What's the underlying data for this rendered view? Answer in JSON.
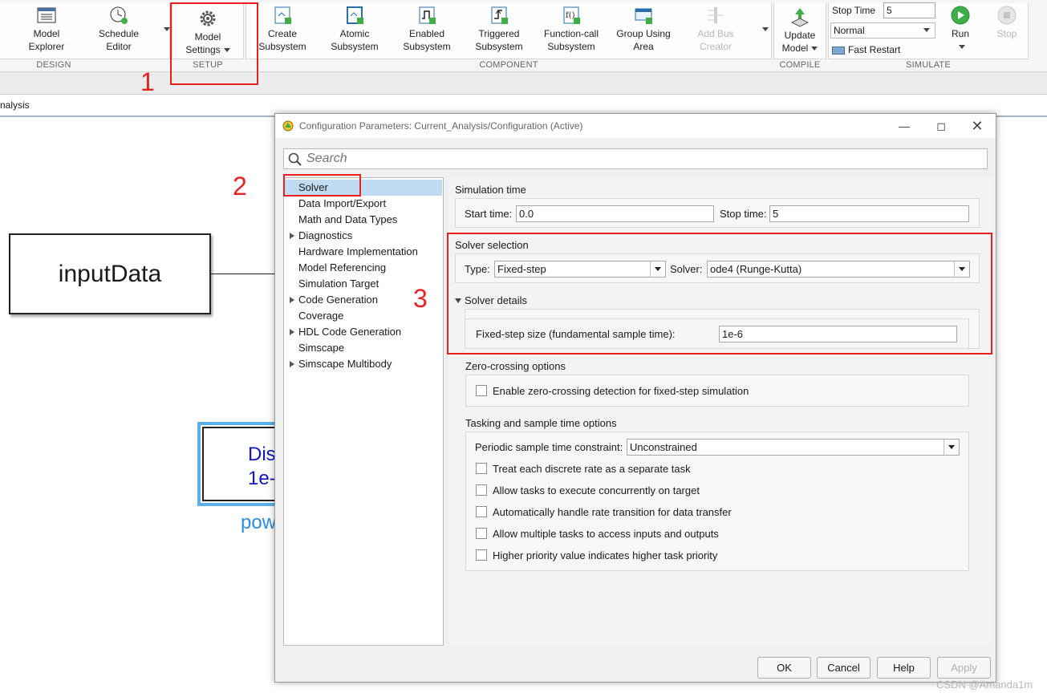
{
  "toolstrip": {
    "model_explorer": "Model\nExplorer",
    "schedule_editor": "Schedule\nEditor",
    "group_design": "DESIGN",
    "model_settings": "Model\nSettings",
    "group_setup": "SETUP",
    "create_subsystem": "Create\nSubsystem",
    "atomic_subsystem": "Atomic\nSubsystem",
    "enabled_subsystem": "Enabled\nSubsystem",
    "triggered_subsystem": "Triggered\nSubsystem",
    "function_call_subsystem": "Function-call\nSubsystem",
    "group_using_area": "Group Using\nArea",
    "add_bus_creator": "Add Bus\nCreator",
    "group_component": "COMPONENT",
    "update_model": "Update\nModel",
    "group_compile": "COMPILE",
    "stop_time_label": "Stop Time",
    "stop_time_value": "5",
    "sim_mode": "Normal",
    "fast_restart": "Fast Restart",
    "run": "Run",
    "stop": "Stop",
    "group_simulate": "SIMULATE"
  },
  "model_path": "nalysis",
  "canvas": {
    "input_block": "inputData",
    "powergui_line1": "Disc",
    "powergui_line2": "1e-",
    "powergui_label": "pow"
  },
  "dialog": {
    "title": "Configuration Parameters: Current_Analysis/Configuration (Active)",
    "search_placeholder": "Search",
    "tree": [
      {
        "label": "Solver",
        "expandable": false
      },
      {
        "label": "Data Import/Export",
        "expandable": false
      },
      {
        "label": "Math and Data Types",
        "expandable": false
      },
      {
        "label": "Diagnostics",
        "expandable": true
      },
      {
        "label": "Hardware Implementation",
        "expandable": false
      },
      {
        "label": "Model Referencing",
        "expandable": false
      },
      {
        "label": "Simulation Target",
        "expandable": false
      },
      {
        "label": "Code Generation",
        "expandable": true
      },
      {
        "label": "Coverage",
        "expandable": false
      },
      {
        "label": "HDL Code Generation",
        "expandable": true
      },
      {
        "label": "Simscape",
        "expandable": false
      },
      {
        "label": "Simscape Multibody",
        "expandable": true
      }
    ],
    "simulation_time": {
      "title": "Simulation time",
      "start_label": "Start time:",
      "start_value": "0.0",
      "stop_label": "Stop time:",
      "stop_value": "5"
    },
    "solver_selection": {
      "title": "Solver selection",
      "type_label": "Type:",
      "type_value": "Fixed-step",
      "solver_label": "Solver:",
      "solver_value": "ode4 (Runge-Kutta)",
      "details_title": "Solver details",
      "step_label": "Fixed-step size (fundamental sample time):",
      "step_value": "1e-6"
    },
    "zero_crossing": {
      "title": "Zero-crossing options",
      "enable_label": "Enable zero-crossing detection for fixed-step simulation",
      "enable_checked": false
    },
    "tasking": {
      "title": "Tasking and sample time options",
      "constraint_label": "Periodic sample time constraint:",
      "constraint_value": "Unconstrained",
      "options": [
        "Treat each discrete rate as a separate task",
        "Allow tasks to execute concurrently on target",
        "Automatically handle rate transition for data transfer",
        "Allow multiple tasks to access inputs and outputs",
        "Higher priority value indicates higher task priority"
      ]
    },
    "buttons": {
      "ok": "OK",
      "cancel": "Cancel",
      "help": "Help",
      "apply": "Apply"
    }
  },
  "annotations": {
    "step1": "1",
    "step2": "2",
    "step3": "3",
    "color": "#e82020"
  },
  "watermark": "CSDN @Amanda1m"
}
